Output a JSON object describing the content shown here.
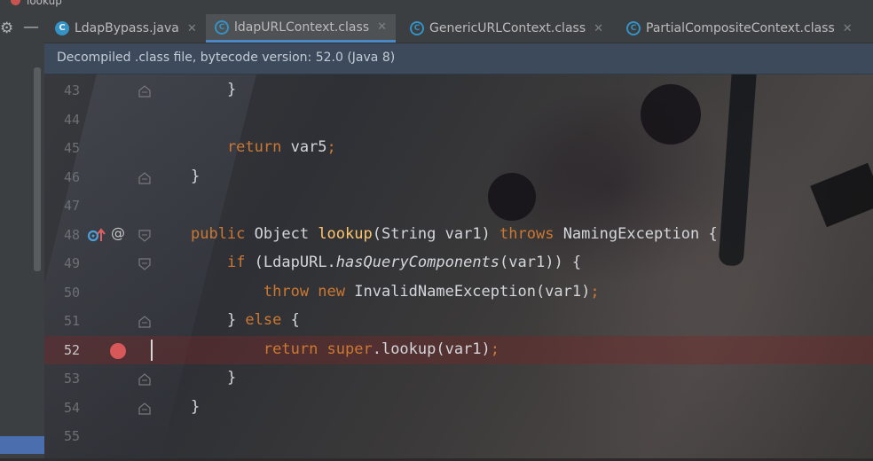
{
  "window": {
    "title": "lookup"
  },
  "tabs": [
    {
      "label": "LdapBypass.java",
      "kind": "java",
      "icon": "java-class-icon"
    },
    {
      "label": "ldapURLContext.class",
      "kind": "class",
      "icon": "compiled-class-icon",
      "active": true
    },
    {
      "label": "GenericURLContext.class",
      "kind": "class",
      "icon": "compiled-class-icon"
    },
    {
      "label": "PartialCompositeContext.class",
      "kind": "class",
      "icon": "compiled-class-icon"
    }
  ],
  "infobar": {
    "text": "Decompiled .class file, bytecode version: 52.0 (Java 8)"
  },
  "editor": {
    "current_line": 52,
    "breakpoint_line": 52,
    "lines": [
      {
        "num": "43",
        "tokens": [
          [
            "plain",
            "    }"
          ]
        ]
      },
      {
        "num": "44",
        "tokens": []
      },
      {
        "num": "45",
        "tokens": [
          [
            "kw",
            "    return "
          ],
          [
            "plain",
            "var5"
          ],
          [
            "semi",
            ";"
          ]
        ]
      },
      {
        "num": "46",
        "tokens": [
          [
            "plain",
            "}"
          ]
        ]
      },
      {
        "num": "47",
        "tokens": []
      },
      {
        "num": "48",
        "tokens": [
          [
            "kw",
            "public "
          ],
          [
            "plain",
            "Object "
          ],
          [
            "fn",
            "lookup"
          ],
          [
            "plain",
            "(String var1) "
          ],
          [
            "kw",
            "throws "
          ],
          [
            "plain",
            "NamingException {"
          ]
        ]
      },
      {
        "num": "49",
        "tokens": [
          [
            "plain",
            "    "
          ],
          [
            "kw",
            "if "
          ],
          [
            "plain",
            "(LdapURL."
          ],
          [
            "it",
            "hasQueryComponents"
          ],
          [
            "plain",
            "(var1)) {"
          ]
        ]
      },
      {
        "num": "50",
        "tokens": [
          [
            "plain",
            "        "
          ],
          [
            "kw",
            "throw new "
          ],
          [
            "plain",
            "InvalidNameException(var1)"
          ],
          [
            "semi",
            ";"
          ]
        ]
      },
      {
        "num": "51",
        "tokens": [
          [
            "plain",
            "    } "
          ],
          [
            "kw",
            "else "
          ],
          [
            "plain",
            "{"
          ]
        ]
      },
      {
        "num": "52",
        "tokens": [
          [
            "plain",
            "        "
          ],
          [
            "kw",
            "return super"
          ],
          [
            "plain",
            ".lookup(var1)"
          ],
          [
            "semi",
            ";"
          ]
        ]
      },
      {
        "num": "53",
        "tokens": [
          [
            "plain",
            "    }"
          ]
        ]
      },
      {
        "num": "54",
        "tokens": [
          [
            "plain",
            "}"
          ]
        ]
      },
      {
        "num": "55",
        "tokens": []
      }
    ]
  },
  "colors": {
    "keyword": "#cc7832",
    "method": "#ffc66d",
    "breakpoint": "#d65858",
    "accent": "#4a88c7"
  }
}
